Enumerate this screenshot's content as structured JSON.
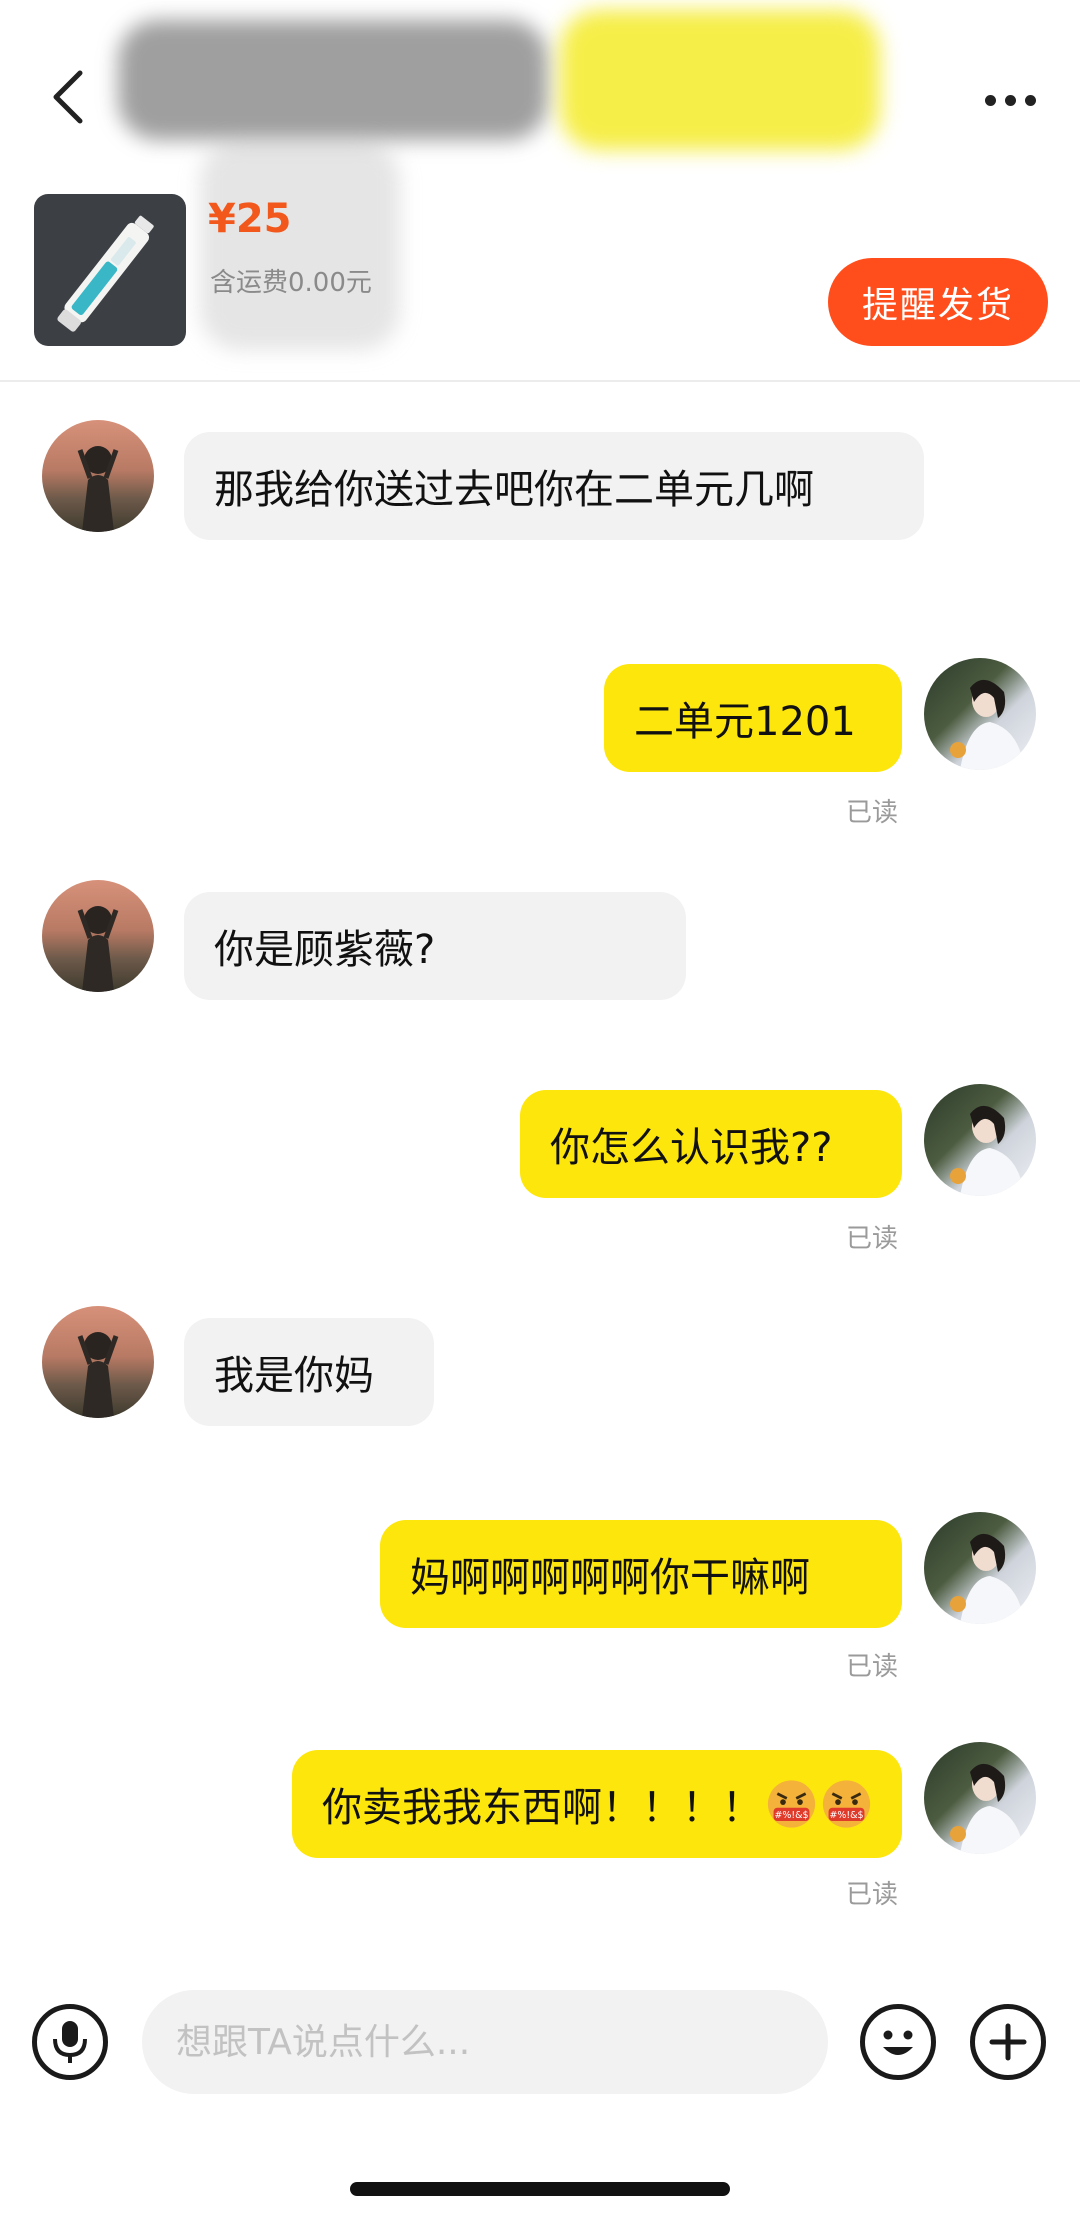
{
  "header": {
    "price": "¥25",
    "shipping": "含运费0.00元",
    "remind_button": "提醒发货"
  },
  "messages": [
    {
      "side": "in",
      "text": "那我给你送过去吧你在二单元几啊"
    },
    {
      "side": "out",
      "text": "二单元1201",
      "status": "已读"
    },
    {
      "side": "in",
      "text": "你是顾紫薇?"
    },
    {
      "side": "out",
      "text": "你怎么认识我??",
      "status": "已读"
    },
    {
      "side": "in",
      "text": "我是你妈"
    },
    {
      "side": "out",
      "text": "妈啊啊啊啊啊你干嘛啊",
      "status": "已读"
    },
    {
      "side": "out",
      "text": "你卖我我东西啊！！！！",
      "status": "已读",
      "emoji": [
        "angry-face-icon",
        "angry-face-icon"
      ]
    }
  ],
  "input": {
    "placeholder": "想跟TA说点什么..."
  },
  "colors": {
    "accent": "#ff4e1c",
    "price": "#f2571c",
    "outgoing_bubble": "#fde60c",
    "incoming_bubble": "#f2f2f2"
  }
}
